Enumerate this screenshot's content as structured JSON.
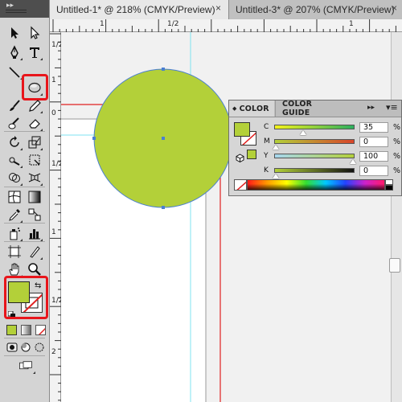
{
  "document_tabs": [
    {
      "title": "Untitled-1* @ 218% (CMYK/Preview)",
      "close": "×",
      "active": true
    },
    {
      "title": "Untitled-3* @ 207% (CMYK/Preview)",
      "close": "×",
      "active": false
    }
  ],
  "ruler_top": {
    "labels": [
      "1",
      "1/2",
      "1"
    ]
  },
  "ruler_left": {
    "labels": [
      "1/2",
      "1",
      "0",
      "1/2",
      "1",
      "1/2",
      "2"
    ]
  },
  "tools": [
    "selection-tool",
    "direct-selection-tool",
    "pen-tool",
    "type-tool",
    "line-segment-tool",
    "ellipse-tool",
    "paintbrush-tool",
    "pencil-tool",
    "blob-brush-tool",
    "eraser-tool",
    "rotate-tool",
    "scale-tool",
    "warp-tool",
    "free-transform-tool",
    "shape-builder-tool",
    "perspective-grid-tool",
    "mesh-tool",
    "gradient-tool",
    "eyedropper-tool",
    "blend-tool",
    "symbol-sprayer-tool",
    "column-graph-tool",
    "artboard-tool",
    "slice-tool",
    "hand-tool",
    "zoom-tool"
  ],
  "fill_stroke": {
    "fill_color": "#b3d039",
    "stroke": "none"
  },
  "artwork": {
    "circle_fill": "#b3d039",
    "circle_stroke": "#4a7fd1",
    "guide_color": "#7fe3f0",
    "bleed_color": "#e02020"
  },
  "color_panel": {
    "tabs": [
      "COLOR",
      "COLOR GUIDE"
    ],
    "collapse_icon": "◆",
    "menu_icon": "▸▸",
    "channels": [
      {
        "label": "C",
        "value": "35",
        "unit": "%",
        "level": 0.35
      },
      {
        "label": "M",
        "value": "0",
        "unit": "%",
        "level": 0.0
      },
      {
        "label": "Y",
        "value": "100",
        "unit": "%",
        "level": 1.0
      },
      {
        "label": "K",
        "value": "0",
        "unit": "%",
        "level": 0.0
      }
    ],
    "fill_color": "#b3d039"
  },
  "highlight_color": "#e8151b"
}
